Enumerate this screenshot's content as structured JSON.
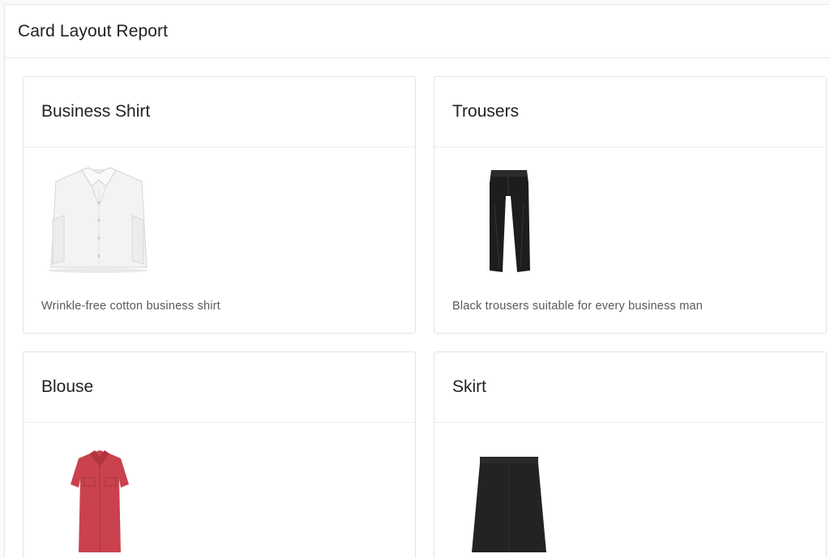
{
  "report": {
    "title": "Card Layout Report"
  },
  "cards": [
    {
      "title": "Business Shirt",
      "description": "Wrinkle-free cotton business shirt",
      "image": "white-shirt-icon"
    },
    {
      "title": "Trousers",
      "description": "Black trousers suitable for every business man",
      "image": "black-trousers-icon"
    },
    {
      "title": "Blouse",
      "description": "",
      "image": "red-blouse-icon"
    },
    {
      "title": "Skirt",
      "description": "",
      "image": "black-skirt-icon"
    }
  ],
  "colors": {
    "shirt": "#f1f1f1",
    "trousers": "#1b1b1b",
    "blouse": "#c8404c",
    "skirt": "#222222"
  }
}
